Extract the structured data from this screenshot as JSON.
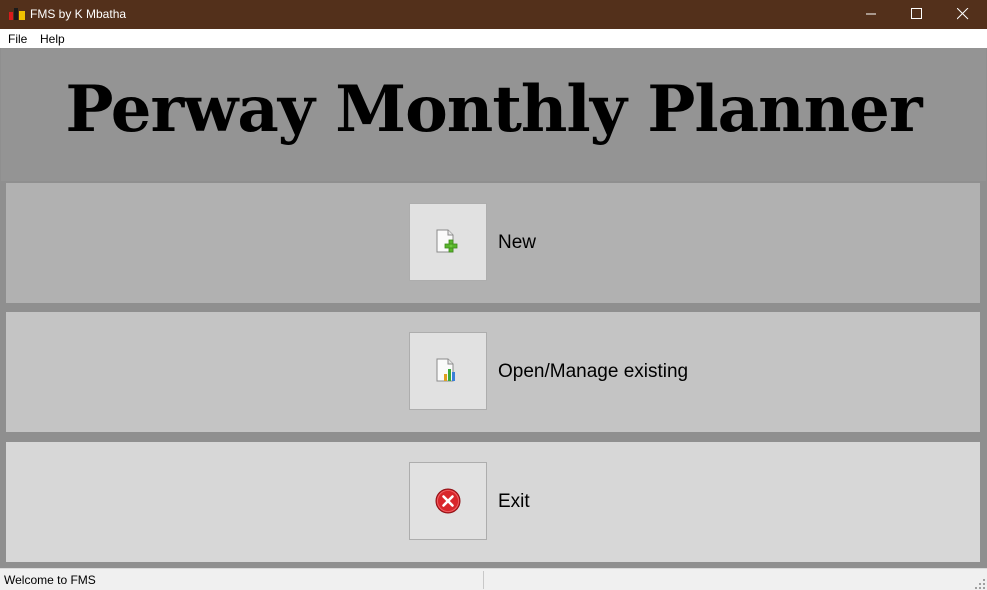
{
  "window": {
    "title": "FMS by K Mbatha"
  },
  "menu": {
    "items": [
      "File",
      "Help"
    ]
  },
  "banner": {
    "title": "Perway Monthly Planner"
  },
  "actions": [
    {
      "label": "New",
      "icon": "new-document-icon"
    },
    {
      "label": "Open/Manage existing",
      "icon": "chart-document-icon"
    },
    {
      "label": "Exit",
      "icon": "exit-icon"
    }
  ],
  "status": {
    "text": "Welcome to FMS"
  },
  "colors": {
    "titlebar": "#53301b",
    "banner": "#949494",
    "panel_new": "#b1b1b1",
    "panel_open": "#c4c4c4",
    "panel_exit": "#d7d7d7"
  }
}
